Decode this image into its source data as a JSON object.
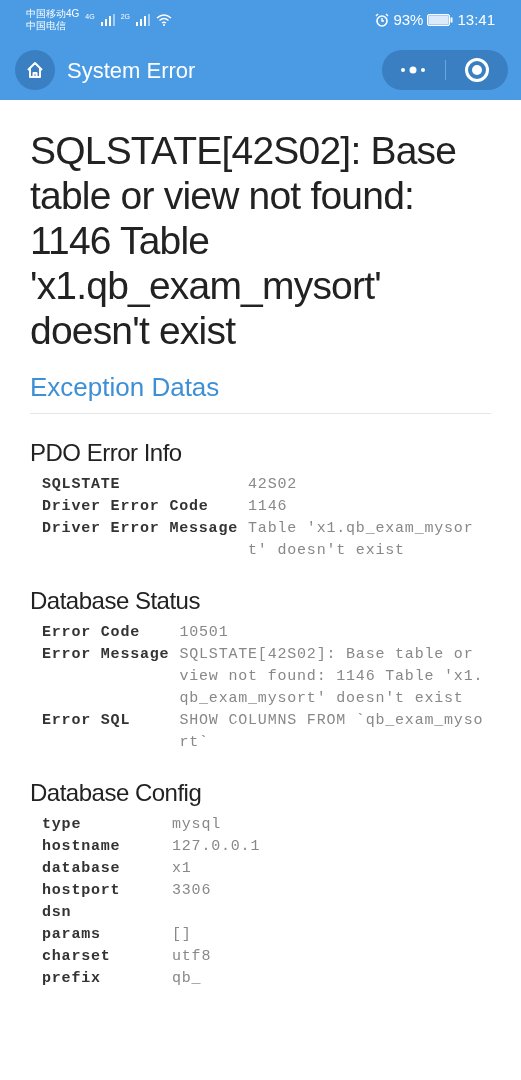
{
  "status_bar": {
    "carrier_1": "中国移动4G",
    "carrier_2": "中国电信",
    "signal_1_label": "4G",
    "signal_2_label": "2G",
    "battery": "93%",
    "time": "13:41"
  },
  "nav_bar": {
    "title": "System Error"
  },
  "error_title": "SQLSTATE[42S02]: Base table or view not found: 1146 Table 'x1.qb_exam_mysort' doesn't exist",
  "exception_heading": "Exception Datas",
  "sections": [
    {
      "title": "PDO Error Info",
      "rows": [
        {
          "key": "SQLSTATE",
          "value": "42S02"
        },
        {
          "key": "Driver Error Code",
          "value": "1146"
        },
        {
          "key": "Driver Error Message",
          "value": "Table 'x1.qb_exam_mysort' doesn't exist"
        }
      ]
    },
    {
      "title": "Database Status",
      "rows": [
        {
          "key": "Error Code",
          "value": "10501"
        },
        {
          "key": "Error Message",
          "value": "SQLSTATE[42S02]: Base table or view not found: 1146 Table 'x1.qb_exam_mysort' doesn't exist"
        },
        {
          "key": "Error SQL",
          "value": "SHOW COLUMNS FROM `qb_exam_mysort`"
        }
      ]
    },
    {
      "title": "Database Config",
      "rows": [
        {
          "key": "type",
          "value": "mysql"
        },
        {
          "key": "hostname",
          "value": "127.0.0.1"
        },
        {
          "key": "database",
          "value": "x1"
        },
        {
          "key": "hostport",
          "value": "3306"
        },
        {
          "key": "dsn",
          "value": ""
        },
        {
          "key": "params",
          "value": "[]"
        },
        {
          "key": "charset",
          "value": "utf8"
        },
        {
          "key": "prefix",
          "value": "qb_"
        }
      ]
    }
  ]
}
